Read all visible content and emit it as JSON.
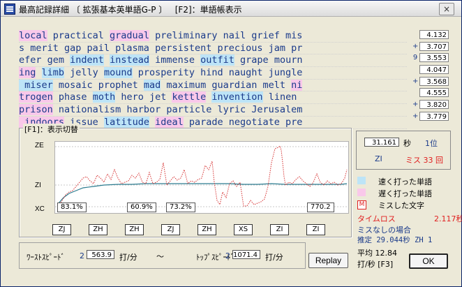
{
  "window": {
    "title": "最高記録詳細 〔 拡張基本英単語G-P 〕   [F2]：単語帳表示",
    "close_label": "×"
  },
  "word_rows": [
    {
      "score": "4.132",
      "mark": "",
      "segments": [
        {
          "t": "local",
          "s": "slow"
        },
        {
          "t": " practical ",
          "s": ""
        },
        {
          "t": "gradual",
          "s": "slow"
        },
        {
          "t": " preliminary nail grief mis",
          "s": ""
        }
      ]
    },
    {
      "score": "3.707",
      "mark": "+",
      "segments": [
        {
          "t": "s merit gap pail plasma persistent precious jam pr",
          "s": ""
        }
      ]
    },
    {
      "score": "3.553",
      "mark": "9",
      "segments": [
        {
          "t": "efer gem ",
          "s": ""
        },
        {
          "t": "indent",
          "s": "fast"
        },
        {
          "t": " ",
          "s": ""
        },
        {
          "t": "instead",
          "s": "fast"
        },
        {
          "t": " immense ",
          "s": ""
        },
        {
          "t": "outfit",
          "s": "fast"
        },
        {
          "t": " grape mourn",
          "s": ""
        }
      ]
    },
    {
      "score": "4.047",
      "mark": "",
      "segments": [
        {
          "t": "ing",
          "s": "slow"
        },
        {
          "t": " ",
          "s": ""
        },
        {
          "t": "limb",
          "s": "fast"
        },
        {
          "t": " jelly ",
          "s": ""
        },
        {
          "t": "mound",
          "s": "fast"
        },
        {
          "t": " prosperity hind naught jungle",
          "s": ""
        }
      ]
    },
    {
      "score": "3.568",
      "mark": "+",
      "segments": [
        {
          "t": " miser",
          "s": "fast"
        },
        {
          "t": " mosaic prophet ",
          "s": ""
        },
        {
          "t": "mad",
          "s": "fast"
        },
        {
          "t": " maximum guardian melt ",
          "s": ""
        },
        {
          "t": "ni",
          "s": "slow"
        }
      ]
    },
    {
      "score": "4.555",
      "mark": "",
      "segments": [
        {
          "t": "trogen",
          "s": "slow"
        },
        {
          "t": " phase ",
          "s": ""
        },
        {
          "t": "moth",
          "s": "fast"
        },
        {
          "t": " hero jet ",
          "s": ""
        },
        {
          "t": "kettle",
          "s": "slow"
        },
        {
          "t": " ",
          "s": ""
        },
        {
          "t": "invention",
          "s": "fast"
        },
        {
          "t": " linen",
          "s": ""
        }
      ]
    },
    {
      "score": "3.820",
      "mark": "+",
      "segments": [
        {
          "t": "prison",
          "s": "slow"
        },
        {
          "t": " nationalism harbor particle lyric Jerusalem",
          "s": ""
        }
      ]
    },
    {
      "score": "3.779",
      "mark": "+",
      "segments": [
        {
          "t": " indoors",
          "s": "slow"
        },
        {
          "t": " issue ",
          "s": ""
        },
        {
          "t": "latitude",
          "s": "fast"
        },
        {
          "t": " ",
          "s": ""
        },
        {
          "t": "ideal",
          "s": "slow"
        },
        {
          "t": " parade negotiate pre",
          "s": ""
        }
      ]
    }
  ],
  "graph": {
    "group_title": "[F1]：表示切替",
    "ylabels": [
      "ZE",
      "ZI",
      "XC"
    ],
    "percents": [
      "83.1%",
      "60.9%",
      "73.2%",
      "770.2"
    ],
    "ranks": [
      "ZJ",
      "ZH",
      "ZH",
      "ZJ",
      "ZH",
      "XS",
      "ZI",
      "ZI"
    ]
  },
  "stats": {
    "time_value": "31.161",
    "time_unit": "秒",
    "rank_label": "1位",
    "level": "ZI",
    "miss_label": "ミス",
    "miss_count": "33",
    "miss_unit": "回"
  },
  "legend": {
    "fast": "速く打った単語",
    "slow": "遅く打った単語",
    "miss_marker": "M",
    "miss": "ミスした文字",
    "colors": {
      "fast": "#bde4f7",
      "slow": "#f9c8ea",
      "miss": "#e02020"
    }
  },
  "loss": {
    "label": "タイムロス",
    "value": "2.117秒",
    "no_miss_label": "ミスなしの場合",
    "estimate_label": "推定",
    "estimate_value": "29.044秒",
    "estimate_rank": "ZH 1"
  },
  "speed": {
    "worst_label": "ﾜｰｽﾄｽﾋﾟｰﾄﾞ",
    "worst_idx": "2",
    "worst_value": "563.9",
    "unit": "打/分",
    "tilde": "～",
    "top_label": "ﾄｯﾌﾟｽﾋﾟｰﾄﾞ",
    "top_idx": "2",
    "top_value": "1071.4"
  },
  "buttons": {
    "replay": "Replay",
    "ok": "OK"
  },
  "average": {
    "line1": "平均 12.84",
    "line2": "打/秒 [F3]"
  }
}
